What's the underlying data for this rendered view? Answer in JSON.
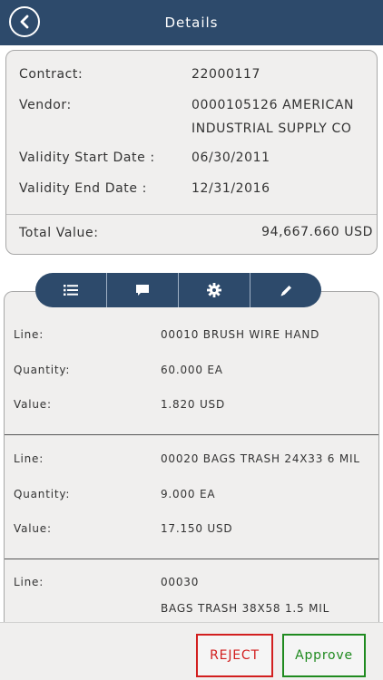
{
  "header": {
    "title": "Details",
    "back_icon": "chevron-left-icon"
  },
  "summary": {
    "contract_label": "Contract:",
    "contract_value": "22000117",
    "vendor_label": "Vendor:",
    "vendor_line1": "0000105126 AMERICAN",
    "vendor_line2": "INDUSTRIAL SUPPLY CO",
    "start_label": "Validity Start Date :",
    "start_value": "06/30/2011",
    "end_label": "Validity End Date :",
    "end_value": "12/31/2016",
    "total_label": "Total Value:",
    "total_value": "94,667.660 USD"
  },
  "tabs": [
    {
      "icon": "list-icon"
    },
    {
      "icon": "comment-icon"
    },
    {
      "icon": "gear-icon"
    },
    {
      "icon": "pencil-icon"
    }
  ],
  "lines": [
    {
      "line_label": "Line:",
      "line_value": "00010 BRUSH WIRE HAND",
      "qty_label": "Quantity:",
      "qty_value": "60.000 EA",
      "value_label": "Value:",
      "value_value": "1.820 USD"
    },
    {
      "line_label": "Line:",
      "line_value": "00020 BAGS TRASH 24X33 6 MIL",
      "qty_label": "Quantity:",
      "qty_value": "9.000 EA",
      "value_label": "Value:",
      "value_value": "17.150 USD"
    },
    {
      "line_label": "Line:",
      "line_value": "00030",
      "line_value2": "BAGS TRASH 38X58 1.5 MIL"
    }
  ],
  "footer": {
    "reject_label": "REJECT",
    "approve_label": "Approve"
  },
  "colors": {
    "header_bg": "#2d4a6b",
    "reject": "#d21f1f",
    "approve": "#1f8a1f",
    "panel_bg": "#f0efee"
  }
}
